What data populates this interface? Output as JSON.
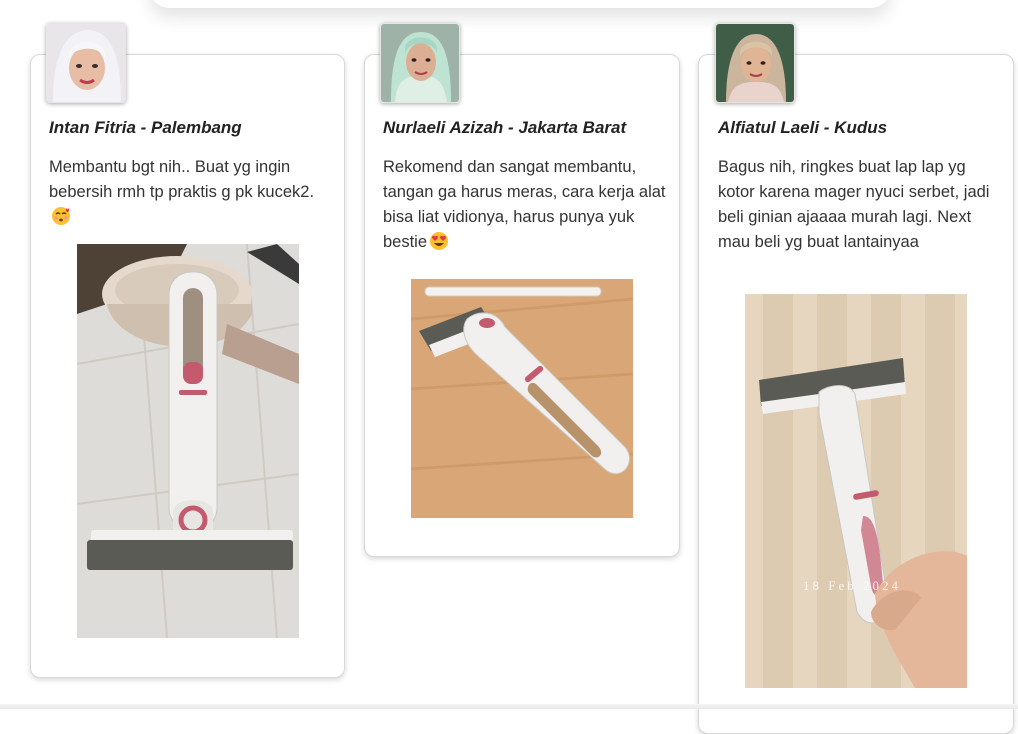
{
  "testimonials": [
    {
      "name": "Intan Fitria - Palembang",
      "text": "Membantu bgt nih.. Buat yg ingin bebersih rmh tp praktis g pk kucek2.",
      "emoji": "kissing-face-with-closed-eyes-icon"
    },
    {
      "name": "Nurlaeli Azizah - Jakarta Barat",
      "text": "Rekomend dan sangat membantu, tangan ga harus meras, cara kerja alat bisa liat vidionya, harus punya yuk bestie",
      "emoji": "heart-eyes-face-icon"
    },
    {
      "name": "Alfiatul Laeli - Kudus",
      "text": "Bagus nih, ringkes buat lap lap yg kotor karena mager nyuci serbet, jadi beli ginian ajaaaa murah lagi. Next mau beli yg buat lantainyaa",
      "photo_watermark": "18 Feb 2024"
    }
  ],
  "colors": {
    "card_border": "#d8d8d8",
    "name_text": "#222222",
    "body_text": "#333333",
    "mop_white": "#f1f0ee",
    "mop_accent": "#c45a6e",
    "sponge_gray": "#5b5b55"
  }
}
